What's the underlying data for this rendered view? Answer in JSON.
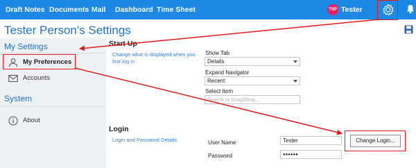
{
  "nav": {
    "links": [
      "Draft Notes",
      "Documents",
      "Mail",
      "Dashboard",
      "Time Sheet"
    ],
    "avatar_initials": "TSP",
    "username": "Tester",
    "bg_color": "#1e88e5",
    "avatar_color": "#e91e63"
  },
  "page": {
    "title": "Tester Person's Settings"
  },
  "sidebar": {
    "section1": "My Settings",
    "items1": [
      {
        "label": "My Preferences",
        "icon": "user-icon"
      },
      {
        "label": "Accounts",
        "icon": "mail-icon"
      }
    ],
    "section2": "System",
    "items2": [
      {
        "label": "About",
        "icon": "info-icon"
      }
    ]
  },
  "startup": {
    "title": "Start Up",
    "description": "Change what is displayed when you first log in",
    "show_tab_label": "Show Tab",
    "show_tab_value": "Details",
    "expand_nav_label": "Expand Navigator",
    "expand_nav_value": "Recent",
    "select_item_label": "Select Item",
    "select_item_placeholder": "Search or Drag/Drop..."
  },
  "login": {
    "title": "Login",
    "description": "Login and Password Details",
    "username_label": "User Name",
    "username_value": "Tester",
    "password_label": "Password",
    "password_value": "●●●●●●",
    "change_button": "Change Login..."
  },
  "annotation_color": "#e31b1b"
}
